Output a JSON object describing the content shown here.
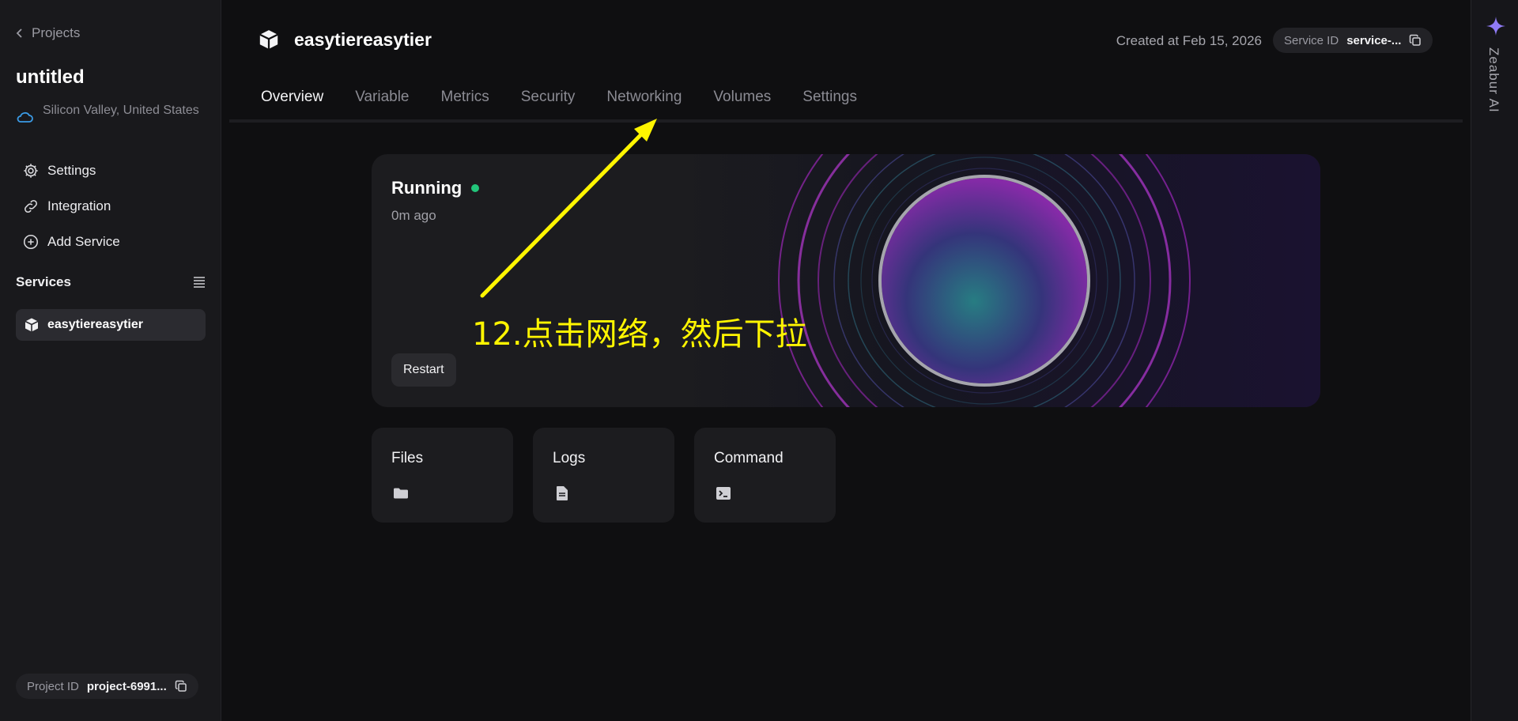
{
  "sidebar": {
    "back_label": "Projects",
    "project_name": "untitled",
    "region": "Silicon Valley, United States",
    "nav": [
      {
        "label": "Settings",
        "icon": "gear-icon"
      },
      {
        "label": "Integration",
        "icon": "link-icon"
      },
      {
        "label": "Add Service",
        "icon": "plus-circle-icon"
      }
    ],
    "services_title": "Services",
    "services": [
      {
        "label": "easytiereasytier",
        "icon": "cube-icon"
      }
    ],
    "project_id_label": "Project ID",
    "project_id_value": "project-6991..."
  },
  "header": {
    "service_name": "easytiereasytier",
    "created": "Created at Feb 15, 2026",
    "service_id_label": "Service ID",
    "service_id_value": "service-..."
  },
  "tabs": [
    "Overview",
    "Variable",
    "Metrics",
    "Security",
    "Networking",
    "Volumes",
    "Settings"
  ],
  "active_tab": "Overview",
  "status": {
    "title": "Running",
    "time": "0m ago",
    "restart_label": "Restart",
    "dot_color": "#22c57a"
  },
  "tools": [
    {
      "label": "Files",
      "icon": "folder-icon"
    },
    {
      "label": "Logs",
      "icon": "document-icon"
    },
    {
      "label": "Command",
      "icon": "terminal-icon"
    }
  ],
  "ai": {
    "label": "Zeabur AI",
    "icon": "sparkle-icon"
  },
  "annotation": {
    "text": "12.点击网络，然后下拉",
    "color": "#fff500"
  },
  "colors": {
    "accent": "#7c3aed",
    "background": "#0f0f11",
    "sidebar": "#19191c"
  }
}
